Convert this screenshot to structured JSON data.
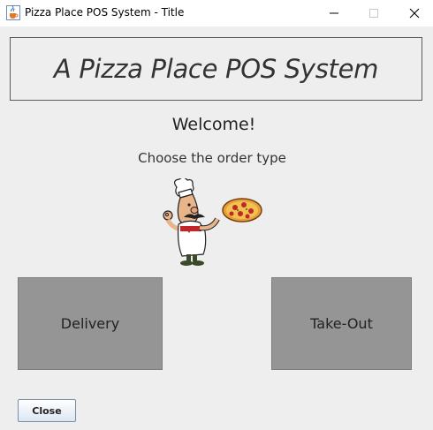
{
  "window": {
    "title": "Pizza Place POS System - Title",
    "app_icon": "java-cup-icon",
    "controls": [
      "minimize-icon",
      "maximize-icon",
      "close-icon"
    ]
  },
  "banner": {
    "text": "A Pizza Place POS System"
  },
  "welcome": "Welcome!",
  "prompt": "Choose the order type",
  "illustration": "pizza-chef-icon",
  "order_buttons": {
    "delivery": "Delivery",
    "takeout": "Take-Out"
  },
  "footer": {
    "close_label": "Close"
  },
  "colors": {
    "background": "#eeeeee",
    "order_button": "#959595",
    "titlebar": "#ffffff"
  }
}
